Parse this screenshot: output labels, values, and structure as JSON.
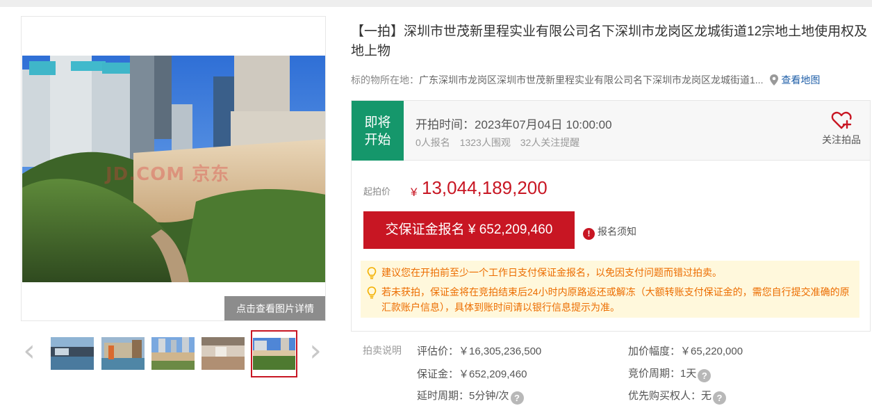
{
  "gallery": {
    "watermark": "JD.COM 京东",
    "detail_button": "点击查看图片详情",
    "prev_icon": "chevron-left-icon",
    "next_icon": "chevron-right-icon",
    "thumbnail_count": 5,
    "active_thumbnail": 5
  },
  "title": "【一拍】深圳市世茂新里程实业有限公司名下深圳市龙岗区龙城街道12宗地土地使用权及地上物",
  "location": {
    "label": "标的物所在地：",
    "value": "广东深圳市龙岗区深圳市世茂新里程实业有限公司名下深圳市龙岗区龙城街道1...",
    "map_link": "查看地图"
  },
  "status": {
    "badge_line1": "即将",
    "badge_line2": "开始",
    "start_time": "开拍时间：2023年07月04日 10:00:00",
    "signups": "0人报名",
    "viewers": "1323人围观",
    "reminders": "32人关注提醒",
    "follow_label": "关注拍品"
  },
  "price": {
    "label": "起拍价",
    "currency": "¥",
    "value": "13,044,189,200"
  },
  "deposit_button": "交保证金报名 ¥ 652,209,460",
  "notice_link": "报名须知",
  "tips": [
    "建议您在开拍前至少一个工作日支付保证金报名，以免因支付问题而错过拍卖。",
    "若未获拍，保证金将在竞拍结束后24小时内原路返还或解冻（大额转账支付保证金的，需您自行提交准确的原汇款账户信息），具体到账时间请以银行信息提示为准。"
  ],
  "details": {
    "heading": "拍卖说明",
    "appraisal": "评估价：￥16,305,236,500",
    "increment": "加价幅度：￥65,220,000",
    "deposit": "保证金：￥652,209,460",
    "bid_period": "竞价周期：1天",
    "extension": "延时周期：5分钟/次",
    "priority": "优先购买权人：无"
  },
  "colors": {
    "accent_red": "#c81623",
    "status_green": "#15976b",
    "tip_orange": "#ec6d00",
    "tip_bg": "#fff8dc",
    "link_blue": "#1f5fa8"
  }
}
